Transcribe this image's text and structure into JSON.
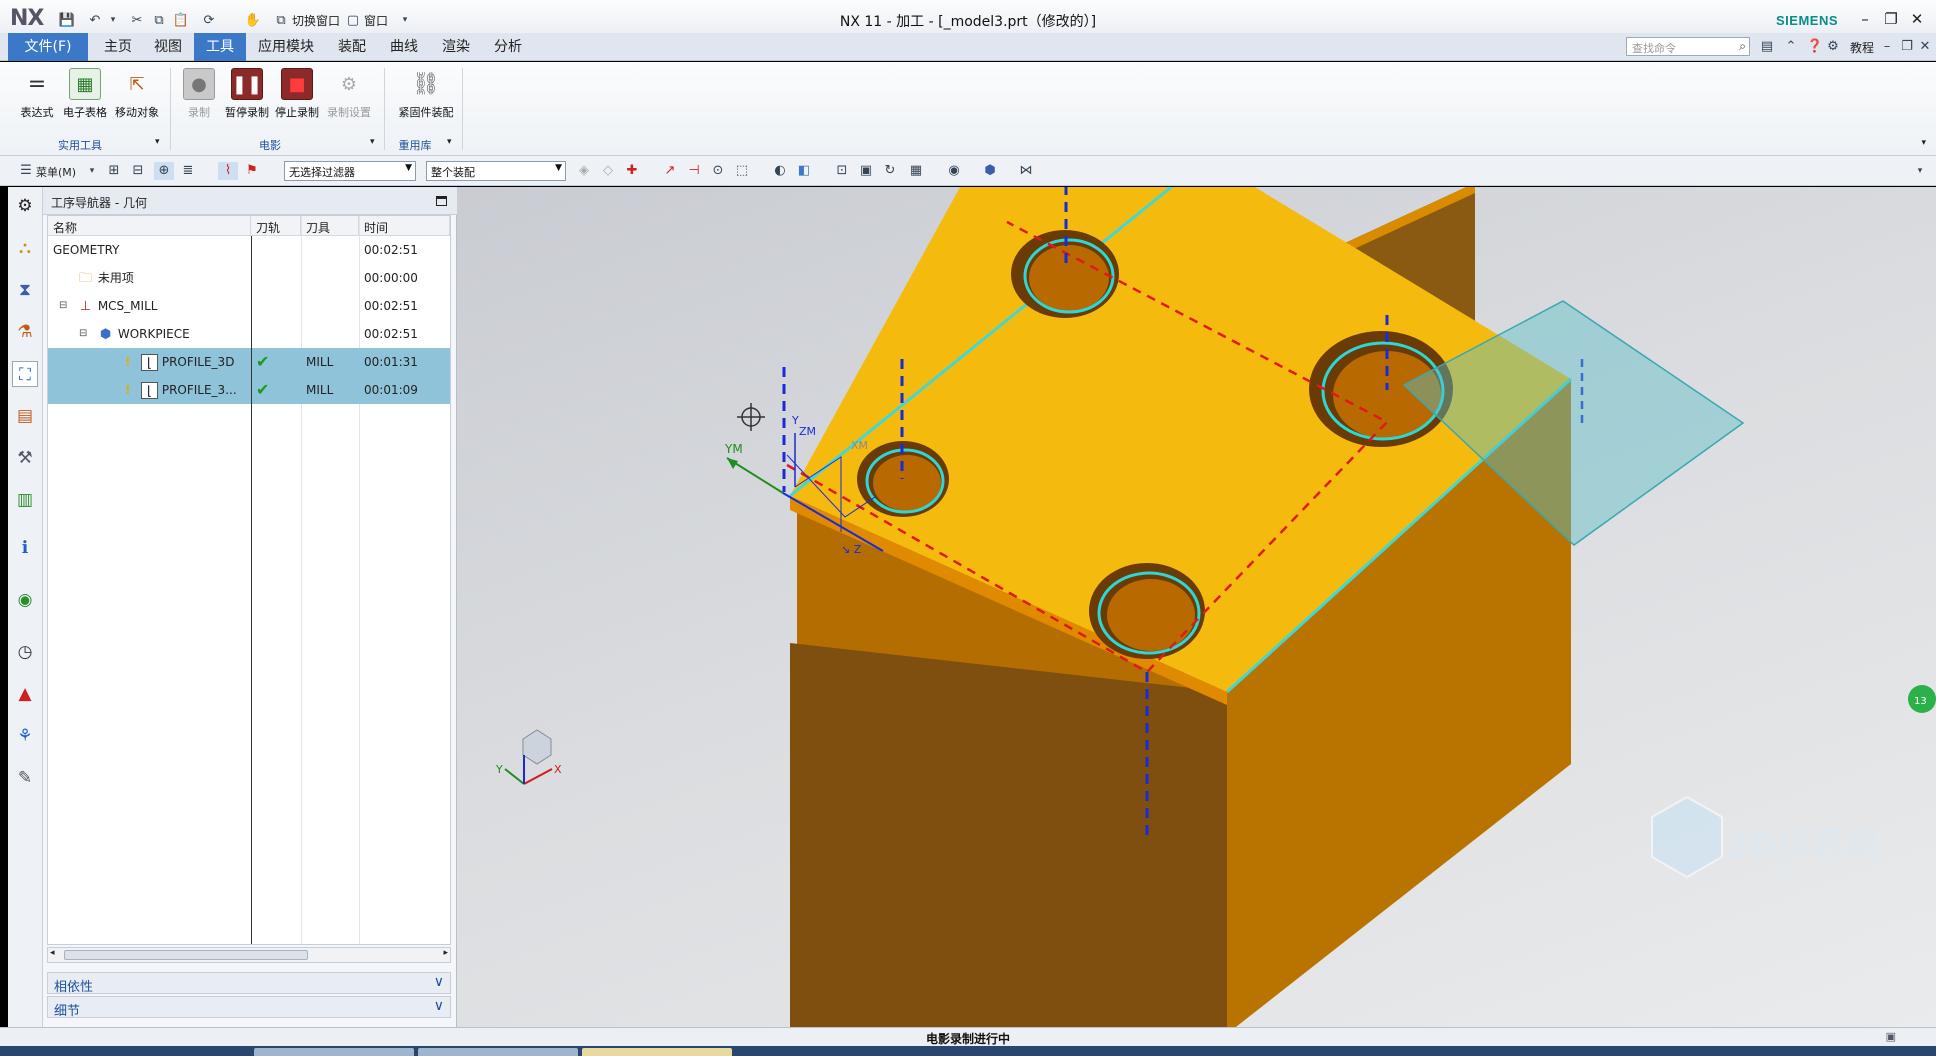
{
  "app": {
    "logo": "NX",
    "window_title": "NX 11 - 加工 - [_model3.prt（修改的）]",
    "brand": "SIEMENS",
    "quick_access": {
      "switch_window": "切换窗口",
      "window": "窗口"
    }
  },
  "menu": {
    "file": "文件(F)",
    "tabs": [
      "主页",
      "视图",
      "工具",
      "应用模块",
      "装配",
      "曲线",
      "渲染",
      "分析"
    ],
    "active_tab": "工具",
    "search_placeholder": "查找命令",
    "help": "教程"
  },
  "ribbon": {
    "groups": [
      {
        "title": "实用工具",
        "buttons": [
          "表达式",
          "电子表格",
          "移动对象"
        ]
      },
      {
        "title": "电影",
        "buttons": [
          "录制",
          "暂停录制",
          "停止录制",
          "录制设置"
        ]
      },
      {
        "title": "重用库",
        "buttons": [
          "紧固件装配"
        ]
      }
    ]
  },
  "toolbar": {
    "menu_label": "菜单(M)",
    "filter_select": "无选择过滤器",
    "assembly_select": "整个装配"
  },
  "navigator": {
    "title": "工序导航器 - 几何",
    "columns": [
      "名称",
      "刀轨",
      "刀具",
      "时间"
    ],
    "rows": [
      {
        "name": "GEOMETRY",
        "path": "",
        "tool": "",
        "time": "00:02:51",
        "level": 0,
        "icon": "",
        "selected": false
      },
      {
        "name": "未用项",
        "path": "",
        "tool": "",
        "time": "00:00:00",
        "level": 1,
        "icon": "folder-icon",
        "selected": false
      },
      {
        "name": "MCS_MILL",
        "path": "",
        "tool": "",
        "time": "00:02:51",
        "level": 1,
        "icon": "mcs-icon",
        "selected": false
      },
      {
        "name": "WORKPIECE",
        "path": "",
        "tool": "",
        "time": "00:02:51",
        "level": 2,
        "icon": "workpiece-icon",
        "selected": false
      },
      {
        "name": "PROFILE_3D",
        "path": "✔",
        "tool": "MILL",
        "time": "00:01:31",
        "level": 3,
        "icon": "operation-icon",
        "selected": true
      },
      {
        "name": "PROFILE_3...",
        "path": "✔",
        "tool": "MILL",
        "time": "00:01:09",
        "level": 3,
        "icon": "operation-icon",
        "selected": true
      }
    ],
    "panels": [
      "相依性",
      "细节"
    ]
  },
  "viewport": {
    "csys_labels": {
      "ym": "YM",
      "xm": "XM",
      "zm": "ZM",
      "y": "Y",
      "z": "Z"
    },
    "triad": {
      "x": "X",
      "y": "Y"
    },
    "watermark": "3D世界网",
    "watermark_sub": "WWW.3DSJW.COM",
    "badge": "13"
  },
  "status": {
    "message": "电影录制进行中"
  }
}
